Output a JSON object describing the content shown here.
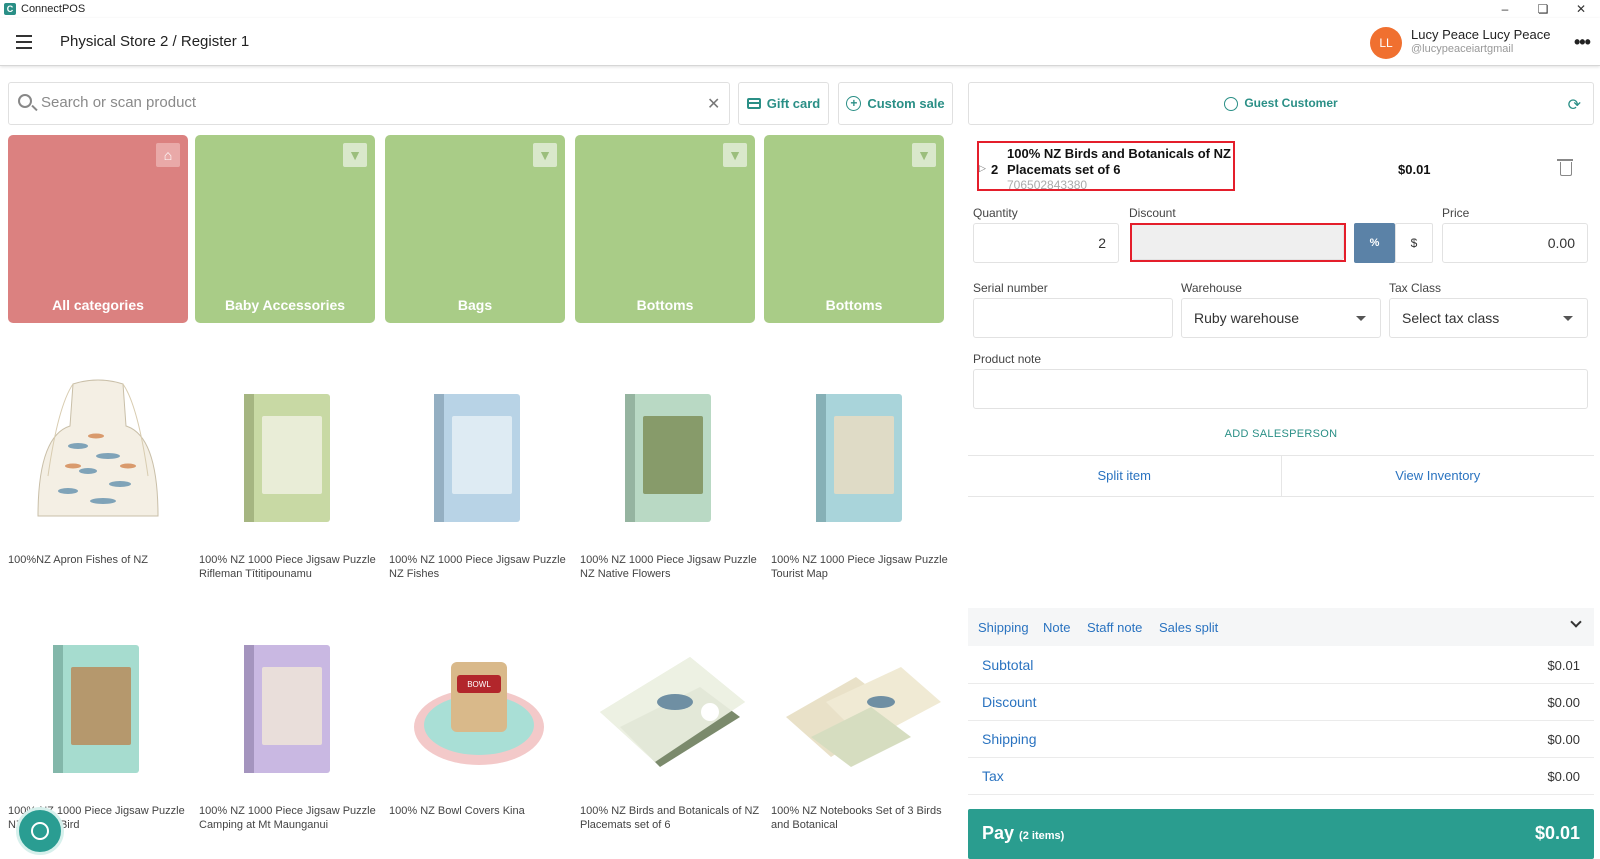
{
  "window": {
    "title": "ConnectPOS"
  },
  "header": {
    "store": "Physical Store 2 / Register 1",
    "user": {
      "initials": "LL",
      "name": "Lucy Peace Lucy Peace",
      "handle": "@lucypeaceiartgmail"
    }
  },
  "search": {
    "placeholder": "Search or scan product"
  },
  "actions": {
    "gift_card": "Gift card",
    "custom_sale": "Custom sale"
  },
  "categories": [
    {
      "label": "All categories",
      "icon": "home-icon"
    },
    {
      "label": "Baby Accessories",
      "icon": "pin-icon"
    },
    {
      "label": "Bags",
      "icon": "pin-icon"
    },
    {
      "label": "Bottoms",
      "icon": "pin-icon"
    },
    {
      "label": "Bottoms",
      "icon": "pin-icon"
    }
  ],
  "products": [
    {
      "name": "100%NZ Apron Fishes of NZ"
    },
    {
      "name": "100% NZ 1000 Piece Jigsaw Puzzle Rifleman Tītitipounamu"
    },
    {
      "name": "100% NZ 1000 Piece Jigsaw Puzzle NZ Fishes"
    },
    {
      "name": "100% NZ 1000 Piece Jigsaw Puzzle NZ Native Flowers"
    },
    {
      "name": "100% NZ 1000 Piece Jigsaw Puzzle Tourist Map"
    },
    {
      "name": "100% NZ 1000 Piece Jigsaw Puzzle NZ Native Bird"
    },
    {
      "name": "100% NZ 1000 Piece Jigsaw Puzzle Camping at Mt Maunganui"
    },
    {
      "name": "100% NZ Bowl Covers Kina"
    },
    {
      "name": "100% NZ Birds and Botanicals of NZ Placemats set of 6"
    },
    {
      "name": "100% NZ Notebooks Set of 3 Birds and Botanical"
    }
  ],
  "cart": {
    "customer": "Guest Customer",
    "item": {
      "qty": "2",
      "name": "100% NZ Birds and Botanicals of NZ Placemats set of 6",
      "sku": "706502843380",
      "price": "$0.01"
    },
    "fields": {
      "quantity_label": "Quantity",
      "quantity_value": "2",
      "discount_label": "Discount",
      "discount_value": "",
      "percent": "%",
      "dollar": "$",
      "price_label": "Price",
      "price_value": "0.00",
      "serial_label": "Serial number",
      "serial_value": "",
      "warehouse_label": "Warehouse",
      "warehouse_value": "Ruby warehouse",
      "taxclass_label": "Tax Class",
      "taxclass_value": "Select tax class",
      "note_label": "Product note",
      "note_value": ""
    },
    "add_salesperson": "ADD SALESPERSON",
    "split_item": "Split item",
    "view_inventory": "View Inventory",
    "tabs": [
      "Shipping",
      "Note",
      "Staff note",
      "Sales split"
    ],
    "totals": [
      {
        "label": "Subtotal",
        "value": "$0.01"
      },
      {
        "label": "Discount",
        "value": "$0.00"
      },
      {
        "label": "Shipping",
        "value": "$0.00"
      },
      {
        "label": "Tax",
        "value": "$0.00"
      }
    ],
    "pay": {
      "label": "Pay",
      "items": "(2 items)",
      "total": "$0.01"
    }
  },
  "colors": {
    "accent": "#2a9d8f",
    "category_all": "#db8180",
    "category": "#a9cc87",
    "highlight": "#e41e2b"
  }
}
